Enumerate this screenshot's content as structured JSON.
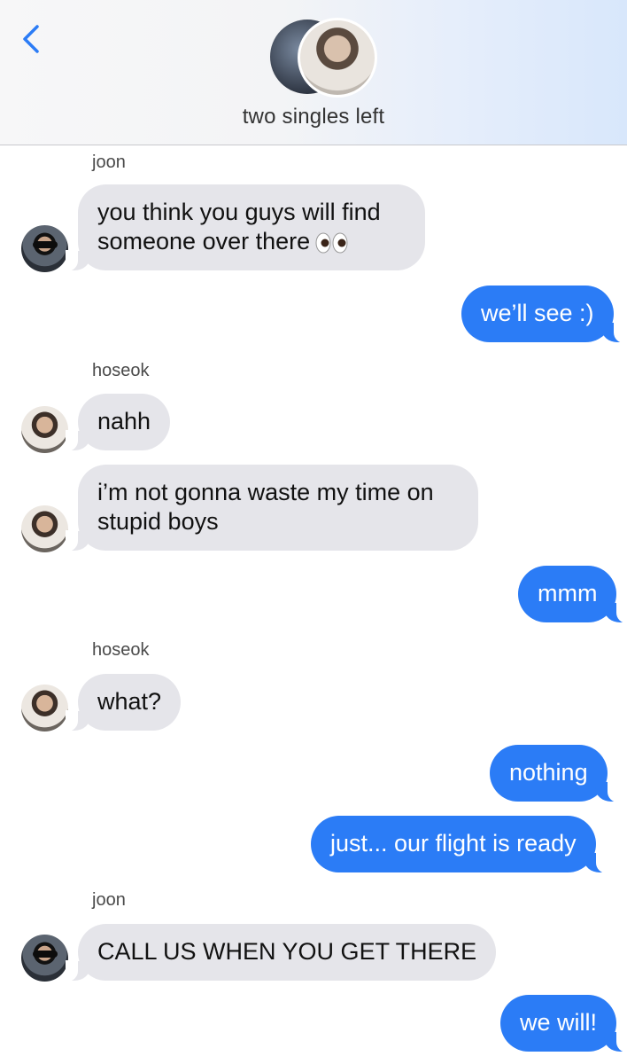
{
  "header": {
    "title": "two singles left",
    "back_icon": "chevron-left-icon",
    "accent": "#2b7cf6"
  },
  "messages": [
    {
      "sender": "joon",
      "direction": "incoming",
      "text": "you think you guys will find someone over there",
      "emoji": "eyes"
    },
    {
      "direction": "outgoing",
      "text": "we’ll see :)"
    },
    {
      "sender": "hoseok",
      "direction": "incoming",
      "text": "nahh"
    },
    {
      "direction": "incoming",
      "text": "i’m not gonna waste my time on stupid boys"
    },
    {
      "direction": "outgoing",
      "text": "mmm"
    },
    {
      "sender": "hoseok",
      "direction": "incoming",
      "text": "what?"
    },
    {
      "direction": "outgoing",
      "text": "nothing"
    },
    {
      "direction": "outgoing",
      "text": "just... our flight is ready"
    },
    {
      "sender": "joon",
      "direction": "incoming",
      "text": "CALL US WHEN YOU GET THERE"
    },
    {
      "direction": "outgoing",
      "text": "we will!"
    }
  ],
  "colors": {
    "incoming_bubble": "#e5e5ea",
    "outgoing_bubble": "#2b7cf6"
  }
}
